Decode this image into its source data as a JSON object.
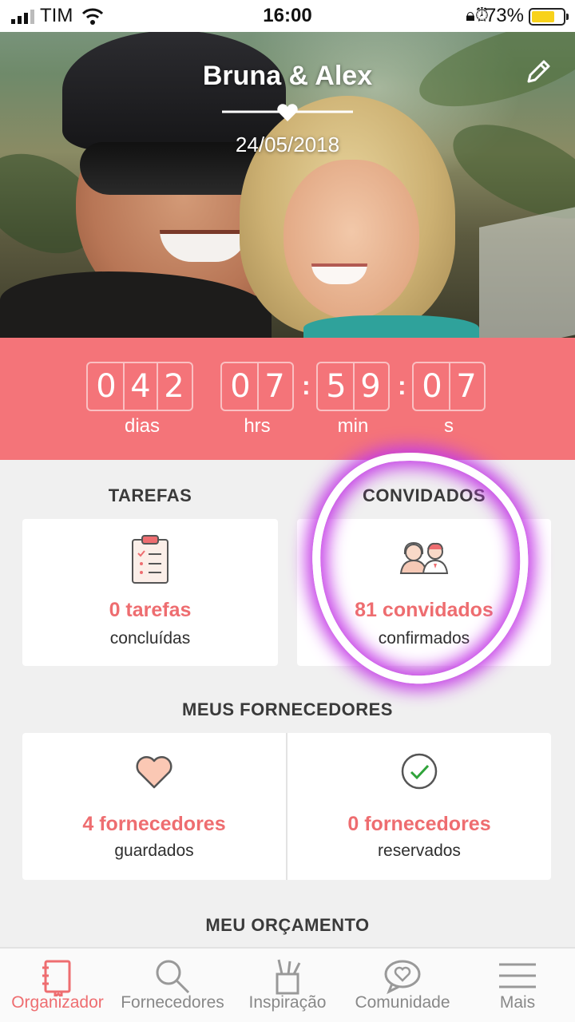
{
  "status_bar": {
    "carrier": "TIM",
    "time": "16:00",
    "battery_percent": "73%",
    "battery_level": 0.73
  },
  "header": {
    "title": "Bruna & Alex",
    "date": "24/05/2018"
  },
  "countdown": {
    "days": [
      "0",
      "4",
      "2"
    ],
    "hours": [
      "0",
      "7"
    ],
    "minutes": [
      "5",
      "9"
    ],
    "seconds": [
      "0",
      "7"
    ],
    "labels": {
      "days": "dias",
      "hours": "hrs",
      "minutes": "min",
      "seconds": "s"
    }
  },
  "tasks": {
    "title": "TAREFAS",
    "count": "0 tarefas",
    "sub": "concluídas"
  },
  "guests": {
    "title": "CONVIDADOS",
    "count": "81 convidados",
    "sub": "confirmados"
  },
  "vendors": {
    "title": "MEUS FORNECEDORES",
    "saved_count": "4 fornecedores",
    "saved_sub": "guardados",
    "booked_count": "0 fornecedores",
    "booked_sub": "reservados"
  },
  "budget": {
    "title": "MEU ORÇAMENTO"
  },
  "tabs": [
    {
      "label": "Organizador",
      "icon": "notebook-icon",
      "active": true
    },
    {
      "label": "Fornecedores",
      "icon": "search-icon",
      "active": false
    },
    {
      "label": "Inspiração",
      "icon": "brushes-icon",
      "active": false
    },
    {
      "label": "Comunidade",
      "icon": "chat-heart-icon",
      "active": false
    },
    {
      "label": "Mais",
      "icon": "menu-icon",
      "active": false
    }
  ],
  "colors": {
    "accent": "#f47479",
    "accent_text": "#ee6d70",
    "highlight": "#c43be6"
  }
}
